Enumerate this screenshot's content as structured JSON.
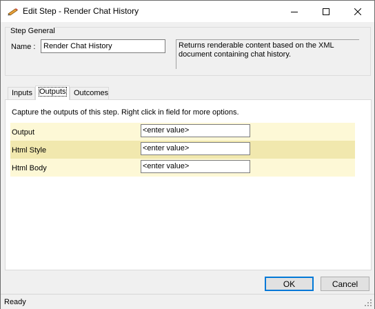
{
  "window": {
    "title": "Edit Step - Render Chat History",
    "app_icon": "pencil-icon",
    "controls": {
      "minimize": "minimize-icon",
      "maximize": "maximize-icon",
      "close": "close-icon"
    }
  },
  "step_general": {
    "legend": "Step General",
    "name_label": "Name :",
    "name_value": "Render Chat History",
    "description": "Returns renderable content based on the XML document containing chat history."
  },
  "tabs": [
    {
      "label": "Inputs",
      "active": false
    },
    {
      "label": "Outputs",
      "active": true
    },
    {
      "label": "Outcomes",
      "active": false
    }
  ],
  "outputs": {
    "caption": "Capture the outputs of this step.  Right click in field for more options.",
    "rows": [
      {
        "label": "Output",
        "value": "<enter value>"
      },
      {
        "label": "Html Style",
        "value": "<enter value>"
      },
      {
        "label": "Html Body",
        "value": "<enter value>"
      }
    ]
  },
  "buttons": {
    "ok": "OK",
    "cancel": "Cancel"
  },
  "status": {
    "text": "Ready"
  },
  "colors": {
    "row_light": "#fdf8d6",
    "row_dark": "#f1e8ae",
    "default_button_border": "#0078d7"
  }
}
